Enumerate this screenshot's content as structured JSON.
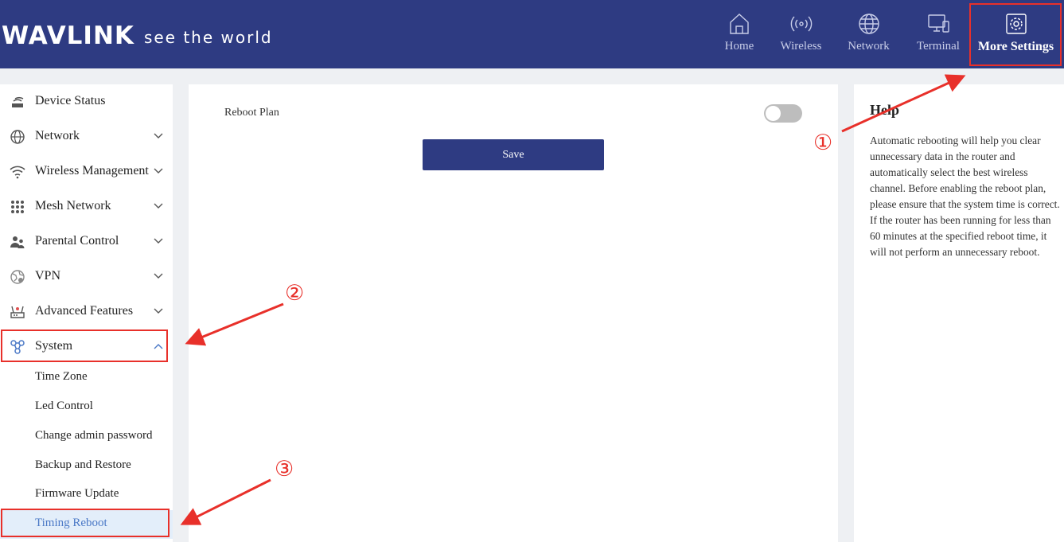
{
  "brand": {
    "name": "WAVLINK",
    "tagline": "see the world"
  },
  "nav": {
    "home": "Home",
    "wireless": "Wireless",
    "network": "Network",
    "terminal": "Terminal",
    "more_settings": "More Settings"
  },
  "sidebar": {
    "items": [
      {
        "label": "Device Status",
        "icon": "router-icon"
      },
      {
        "label": "Network",
        "icon": "globe-icon"
      },
      {
        "label": "Wireless Management",
        "icon": "wifi-icon"
      },
      {
        "label": "Mesh Network",
        "icon": "mesh-grid-icon"
      },
      {
        "label": "Parental Control",
        "icon": "parental-icon"
      },
      {
        "label": "VPN",
        "icon": "vpn-icon"
      },
      {
        "label": "Advanced Features",
        "icon": "advanced-router-icon"
      },
      {
        "label": "System",
        "icon": "system-nodes-icon"
      }
    ],
    "system_sub": [
      "Time Zone",
      "Led Control",
      "Change admin password",
      "Backup and Restore",
      "Firmware Update",
      "Timing Reboot"
    ]
  },
  "main": {
    "reboot_plan_label": "Reboot Plan",
    "reboot_plan_enabled": false,
    "save_label": "Save"
  },
  "help": {
    "title": "Help",
    "text": "Automatic rebooting will help you clear unnecessary data in the router and automatically select the best wireless channel. Before enabling the reboot plan, please ensure that the system time is correct. If the router has been running for less than 60 minutes at the specified reboot time, it will not perform an unnecessary reboot."
  },
  "annotations": {
    "step1": "①",
    "step2": "②",
    "step3": "③"
  },
  "colors": {
    "header_bg": "#2e3b82",
    "highlight": "#e8302a",
    "active_sub": "#4a78c6"
  }
}
